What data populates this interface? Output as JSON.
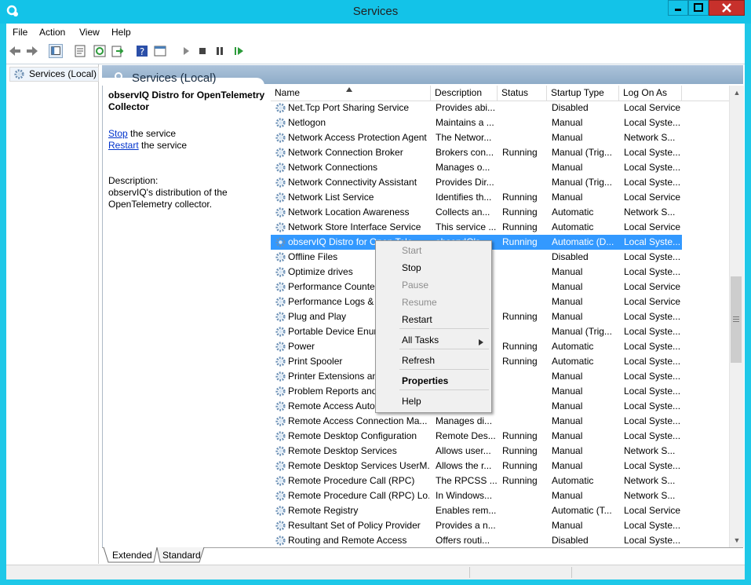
{
  "window": {
    "title": "Services"
  },
  "menu": [
    "File",
    "Action",
    "View",
    "Help"
  ],
  "tree": {
    "root_label": "Services (Local)"
  },
  "pane": {
    "title": "Services (Local)"
  },
  "selected": {
    "name": "observIQ Distro for OpenTelemetry Collector",
    "stop_link": "Stop",
    "stop_suffix": " the service",
    "restart_link": "Restart",
    "restart_suffix": " the service",
    "description_label": "Description:",
    "description": "observIQ's distribution of the OpenTelemetry collector."
  },
  "columns": [
    "Name",
    "Description",
    "Status",
    "Startup Type",
    "Log On As"
  ],
  "rows": [
    {
      "name": "Net.Tcp Port Sharing Service",
      "desc": "Provides abi...",
      "status": "",
      "startup": "Disabled",
      "logon": "Local Service"
    },
    {
      "name": "Netlogon",
      "desc": "Maintains a ...",
      "status": "",
      "startup": "Manual",
      "logon": "Local Syste..."
    },
    {
      "name": "Network Access Protection Agent",
      "desc": "The Networ...",
      "status": "",
      "startup": "Manual",
      "logon": "Network S..."
    },
    {
      "name": "Network Connection Broker",
      "desc": "Brokers con...",
      "status": "Running",
      "startup": "Manual (Trig...",
      "logon": "Local Syste..."
    },
    {
      "name": "Network Connections",
      "desc": "Manages o...",
      "status": "",
      "startup": "Manual",
      "logon": "Local Syste..."
    },
    {
      "name": "Network Connectivity Assistant",
      "desc": "Provides Dir...",
      "status": "",
      "startup": "Manual (Trig...",
      "logon": "Local Syste..."
    },
    {
      "name": "Network List Service",
      "desc": "Identifies th...",
      "status": "Running",
      "startup": "Manual",
      "logon": "Local Service"
    },
    {
      "name": "Network Location Awareness",
      "desc": "Collects an...",
      "status": "Running",
      "startup": "Automatic",
      "logon": "Network S..."
    },
    {
      "name": "Network Store Interface Service",
      "desc": "This service ...",
      "status": "Running",
      "startup": "Automatic",
      "logon": "Local Service"
    },
    {
      "name": "observIQ Distro for Open Tele...",
      "desc": "observIQ's...",
      "status": "Running",
      "startup": "Automatic (D...",
      "logon": "Local Syste...",
      "selected": true
    },
    {
      "name": "Offline Files",
      "desc": "",
      "status": "",
      "startup": "Disabled",
      "logon": "Local Syste..."
    },
    {
      "name": "Optimize drives",
      "desc": "",
      "status": "",
      "startup": "Manual",
      "logon": "Local Syste..."
    },
    {
      "name": "Performance Counte",
      "desc": "...",
      "status": "",
      "startup": "Manual",
      "logon": "Local Service"
    },
    {
      "name": "Performance Logs &",
      "desc": "...",
      "status": "",
      "startup": "Manual",
      "logon": "Local Service"
    },
    {
      "name": "Plug and Play",
      "desc": "",
      "status": "Running",
      "startup": "Manual",
      "logon": "Local Syste..."
    },
    {
      "name": "Portable Device Enur",
      "desc": "...",
      "status": "",
      "startup": "Manual (Trig...",
      "logon": "Local Syste..."
    },
    {
      "name": "Power",
      "desc": "",
      "status": "Running",
      "startup": "Automatic",
      "logon": "Local Syste..."
    },
    {
      "name": "Print Spooler",
      "desc": "...",
      "status": "Running",
      "startup": "Automatic",
      "logon": "Local Syste..."
    },
    {
      "name": "Printer Extensions an",
      "desc": "...",
      "status": "",
      "startup": "Manual",
      "logon": "Local Syste..."
    },
    {
      "name": "Problem Reports and",
      "desc": "...",
      "status": "",
      "startup": "Manual",
      "logon": "Local Syste..."
    },
    {
      "name": "Remote Access Auto",
      "desc": "...",
      "status": "",
      "startup": "Manual",
      "logon": "Local Syste..."
    },
    {
      "name": "Remote Access Connection Ma...",
      "desc": "Manages di...",
      "status": "",
      "startup": "Manual",
      "logon": "Local Syste..."
    },
    {
      "name": "Remote Desktop Configuration",
      "desc": "Remote Des...",
      "status": "Running",
      "startup": "Manual",
      "logon": "Local Syste..."
    },
    {
      "name": "Remote Desktop Services",
      "desc": "Allows user...",
      "status": "Running",
      "startup": "Manual",
      "logon": "Network S..."
    },
    {
      "name": "Remote Desktop Services UserM...",
      "desc": "Allows the r...",
      "status": "Running",
      "startup": "Manual",
      "logon": "Local Syste..."
    },
    {
      "name": "Remote Procedure Call (RPC)",
      "desc": "The RPCSS ...",
      "status": "Running",
      "startup": "Automatic",
      "logon": "Network S..."
    },
    {
      "name": "Remote Procedure Call (RPC) Lo...",
      "desc": "In Windows...",
      "status": "",
      "startup": "Manual",
      "logon": "Network S..."
    },
    {
      "name": "Remote Registry",
      "desc": "Enables rem...",
      "status": "",
      "startup": "Automatic (T...",
      "logon": "Local Service"
    },
    {
      "name": "Resultant Set of Policy Provider",
      "desc": "Provides a n...",
      "status": "",
      "startup": "Manual",
      "logon": "Local Syste..."
    },
    {
      "name": "Routing and Remote Access",
      "desc": "Offers routi...",
      "status": "",
      "startup": "Disabled",
      "logon": "Local Syste..."
    }
  ],
  "context_menu": [
    {
      "label": "Start",
      "disabled": true
    },
    {
      "label": "Stop"
    },
    {
      "label": "Pause",
      "disabled": true
    },
    {
      "label": "Resume",
      "disabled": true
    },
    {
      "label": "Restart"
    },
    {
      "label": "All Tasks",
      "submenu": true
    },
    {
      "label": "Refresh"
    },
    {
      "label": "Properties",
      "bold": true
    },
    {
      "label": "Help"
    }
  ],
  "tabs": [
    "Extended",
    "Standard"
  ],
  "colors": {
    "titlebar": "#13c3e8",
    "selection": "#3399ff",
    "close": "#c7302b",
    "link": "#0033cc"
  },
  "icons": [
    "services-app-icon",
    "minimize-icon",
    "maximize-icon",
    "close-icon",
    "back-icon",
    "forward-icon",
    "show-hide-tree-icon",
    "properties-icon",
    "refresh-icon",
    "export-icon",
    "help-icon",
    "view-icon",
    "play-icon",
    "stop-icon",
    "pause-icon",
    "resume-icon",
    "gear-icon"
  ]
}
